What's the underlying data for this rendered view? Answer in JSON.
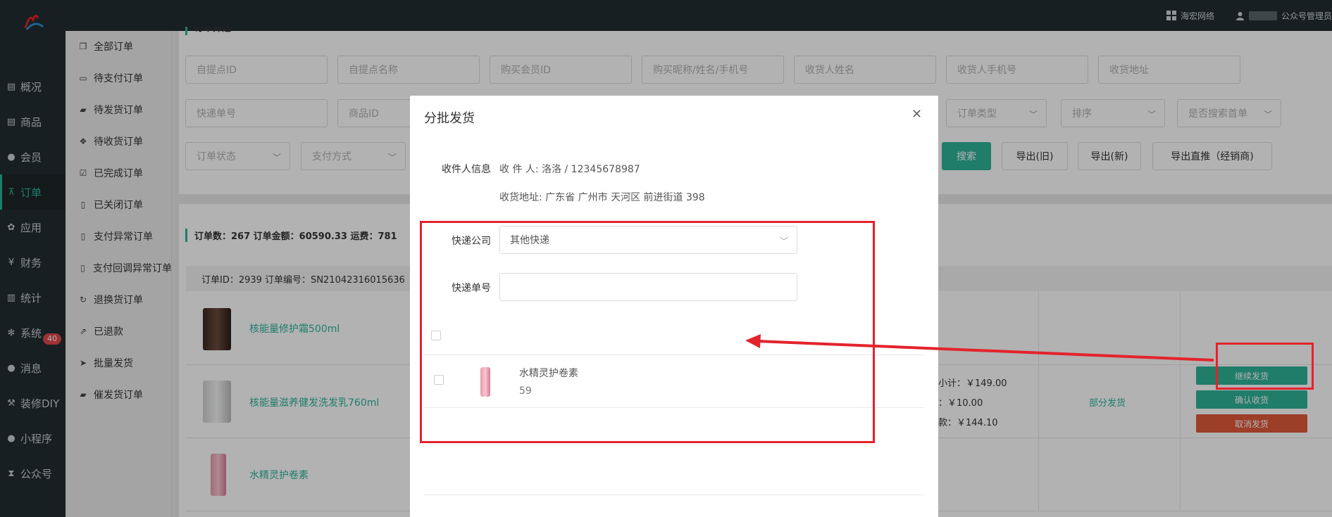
{
  "topbar": {
    "company": "海宏网络",
    "account": "公众号管理员"
  },
  "nav1": [
    {
      "label": "概况",
      "icon": "dashboard-icon"
    },
    {
      "label": "商品",
      "icon": "goods-icon"
    },
    {
      "label": "会员",
      "icon": "members-icon"
    },
    {
      "label": "订单",
      "icon": "cart-icon",
      "active": true
    },
    {
      "label": "应用",
      "icon": "apps-icon"
    },
    {
      "label": "财务",
      "icon": "yen-icon"
    },
    {
      "label": "统计",
      "icon": "stats-icon"
    },
    {
      "label": "系统",
      "icon": "gear-icon"
    },
    {
      "label": "消息",
      "icon": "chat-icon"
    },
    {
      "label": "装修DIY",
      "icon": "hammer-icon"
    },
    {
      "label": "小程序",
      "icon": "wechat-icon"
    },
    {
      "label": "公众号",
      "icon": "hourglass-icon"
    }
  ],
  "message_badge": "40",
  "nav2": [
    {
      "label": "全部订单",
      "icon": "copy-icon"
    },
    {
      "label": "待支付订单",
      "icon": "card-icon"
    },
    {
      "label": "待发货订单",
      "icon": "truck-icon"
    },
    {
      "label": "待收货订单",
      "icon": "dropbox-icon"
    },
    {
      "label": "已完成订单",
      "icon": "check-square-icon"
    },
    {
      "label": "已关闭订单",
      "icon": "trash-icon"
    },
    {
      "label": "支付异常订单",
      "icon": "trash-icon"
    },
    {
      "label": "支付回调异常订单",
      "icon": "trash-icon"
    },
    {
      "label": "退换货订单",
      "icon": "refresh-icon"
    },
    {
      "label": "已退款",
      "icon": "external-icon"
    },
    {
      "label": "批量发货",
      "icon": "send-icon"
    },
    {
      "label": "催发货订单",
      "icon": "truck-icon"
    }
  ],
  "filter": {
    "title": "订单筛选",
    "row1": [
      "自提点ID",
      "自提点名称",
      "购买会员ID",
      "购买昵称/姓名/手机号",
      "收货人姓名",
      "收货人手机号",
      "收货地址"
    ],
    "row2_left": [
      "快递单号",
      "商品ID"
    ],
    "row2_right": [
      "订单类型",
      "排序",
      "是否搜索首单"
    ],
    "row3": [
      "订单状态",
      "支付方式"
    ],
    "buttons": {
      "search": "搜索",
      "export_old": "导出(旧)",
      "export_new": "导出(新)",
      "export_direct": "导出直推（经销商)"
    }
  },
  "summary": {
    "text": "订单数：267    订单金额：60590.33    运费：781"
  },
  "order": {
    "header": "订单ID：2939    订单编号：SN21042316015636",
    "products": [
      {
        "name": "核能量修护霜500ml"
      },
      {
        "name": "核能量滋养健发洗发乳760ml"
      },
      {
        "name": "水精灵护卷素"
      }
    ],
    "subtotal": "小计：￥149.00",
    "freight": "：￥10.00",
    "paid": "款：￥144.10",
    "status": "部分发货",
    "actions": {
      "continue": "继续发货",
      "confirm": "确认收货",
      "cancel": "取消发货"
    }
  },
  "modal": {
    "title": "分批发货",
    "receiver_label": "收件人信息",
    "receiver": "收 件 人: 洛洛 / 12345678987",
    "address": "收货地址: 广东省 广州市 天河区 前进街道 398",
    "express_company_label": "快递公司",
    "express_company_value": "其他快递",
    "express_no_label": "快递单号",
    "express_no_value": "",
    "item": {
      "name": "水精灵护卷素",
      "qty": "59"
    }
  },
  "colors": {
    "accent": "#2eb398",
    "danger": "#e3232c",
    "cancel": "#e05a3a",
    "sidebar": "#222d32"
  }
}
